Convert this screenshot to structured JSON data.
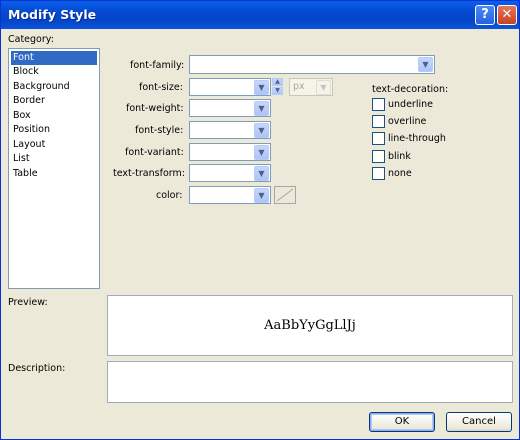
{
  "window": {
    "title": "Modify Style",
    "help_glyph": "?",
    "close_glyph": "✕"
  },
  "category": {
    "label": "Category:",
    "items": [
      {
        "label": "Font",
        "selected": true
      },
      {
        "label": "Block",
        "selected": false
      },
      {
        "label": "Background",
        "selected": false
      },
      {
        "label": "Border",
        "selected": false
      },
      {
        "label": "Box",
        "selected": false
      },
      {
        "label": "Position",
        "selected": false
      },
      {
        "label": "Layout",
        "selected": false
      },
      {
        "label": "List",
        "selected": false
      },
      {
        "label": "Table",
        "selected": false
      }
    ]
  },
  "font": {
    "family_label": "font-family:",
    "size_label": "font-size:",
    "size_unit": "px",
    "weight_label": "font-weight:",
    "style_label": "font-style:",
    "variant_label": "font-variant:",
    "transform_label": "text-transform:",
    "color_label": "color:"
  },
  "decoration": {
    "label": "text-decoration:",
    "options": [
      "underline",
      "overline",
      "line-through",
      "blink",
      "none"
    ]
  },
  "preview": {
    "label": "Preview:",
    "sample": "AaBbYyGgLlJj"
  },
  "description": {
    "label": "Description:"
  },
  "buttons": {
    "ok": "OK",
    "cancel": "Cancel"
  },
  "icons": {
    "dropdown": "chevron-down-icon",
    "help": "help-icon",
    "close": "close-icon"
  }
}
